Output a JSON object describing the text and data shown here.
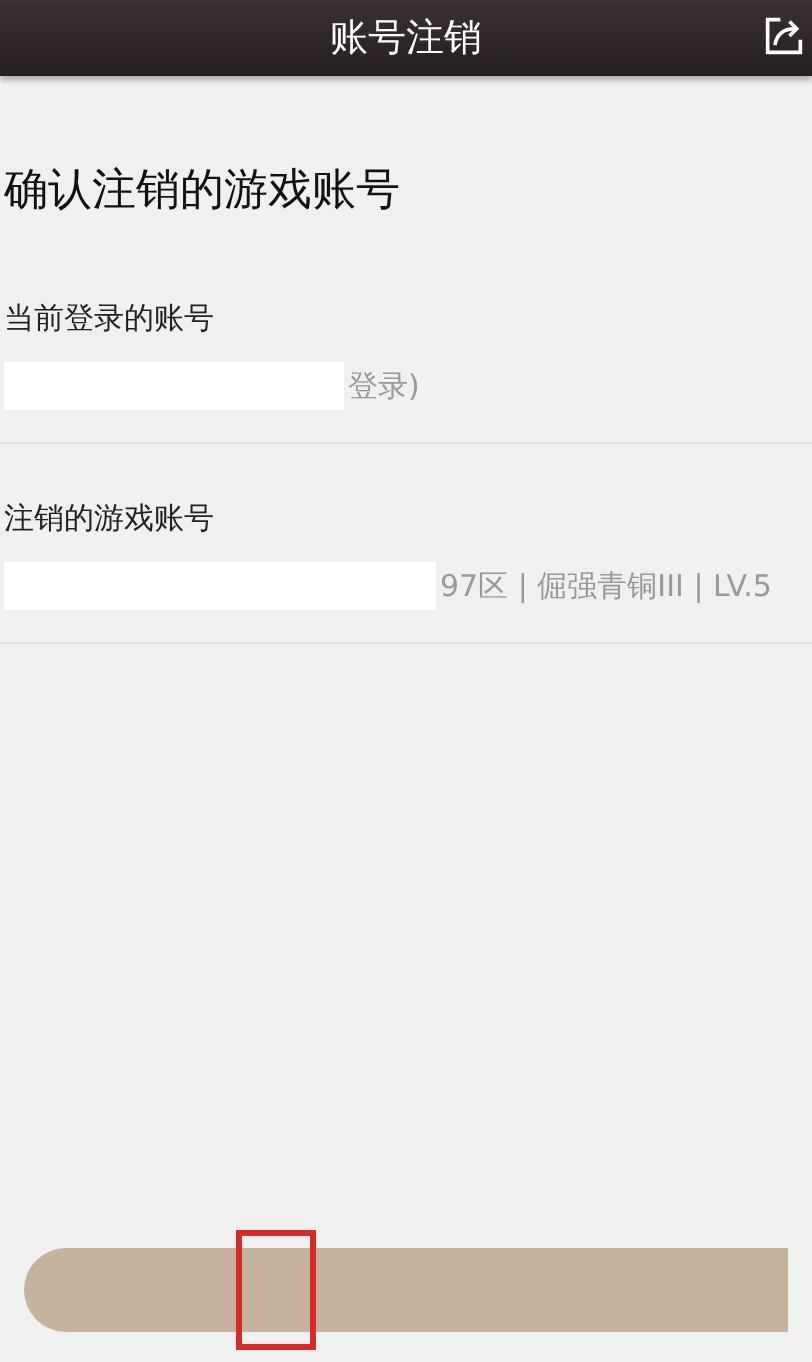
{
  "header": {
    "title": "账号注销"
  },
  "heading": "确认注销的游戏账号",
  "sections": [
    {
      "label": "当前登录的账号",
      "value": "登录)"
    },
    {
      "label": "注销的游戏账号",
      "value": "97区 | 倔强青铜III | LV.5"
    }
  ],
  "button": {
    "highlighted": true
  }
}
